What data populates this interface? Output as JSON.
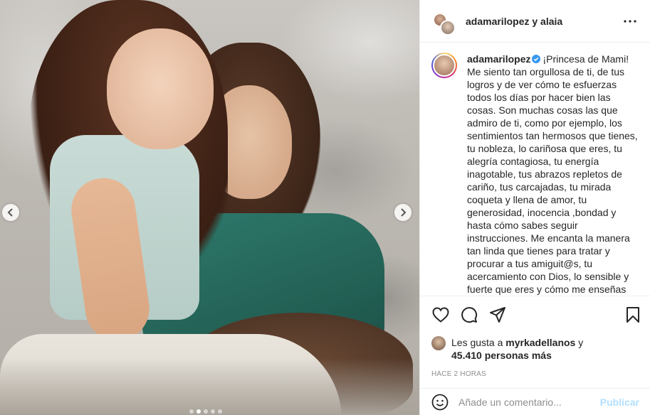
{
  "photo": {
    "carousel_dots": 5,
    "active_dot": 1
  },
  "header": {
    "title": "adamarilopez y alaia",
    "more_icon": "more-horizontal-icon"
  },
  "caption": {
    "username": "adamarilopez",
    "verified_icon": "verified-badge-icon",
    "text": "¡Princesa de Mami! Me siento tan orgullosa de ti, de tus logros y de ver cómo te esfuerzas todos los días por hacer bien las cosas. Son muchas cosas las que admiro de ti, como por ejemplo, los sentimientos tan hermosos que tienes, tu nobleza, lo cariñosa que eres, tu alegría contagiosa, tu energía inagotable, tus abrazos repletos de cariño, tus carcajadas, tu mirada coqueta y llena de amor, tu generosidad, inocencia ,bondad y hasta cómo sabes seguir instrucciones. Me encanta la manera tan linda que tienes para tratar y procurar a tus amiguit@s, tu acercamiento con Dios, lo sensible y fuerte que eres y cómo me enseñas"
  },
  "actions": {
    "like_icon": "heart-icon",
    "comment_icon": "comment-icon",
    "share_icon": "share-icon",
    "save_icon": "bookmark-icon"
  },
  "likes": {
    "prefix": "Les gusta a ",
    "user": "myrkadellanos",
    "middle": " y ",
    "count": "45.410 personas más"
  },
  "timestamp": "Hace 2 horas",
  "comment": {
    "emoji_icon": "emoji-icon",
    "placeholder": "Añade un comentario...",
    "publish_label": "Publicar"
  }
}
